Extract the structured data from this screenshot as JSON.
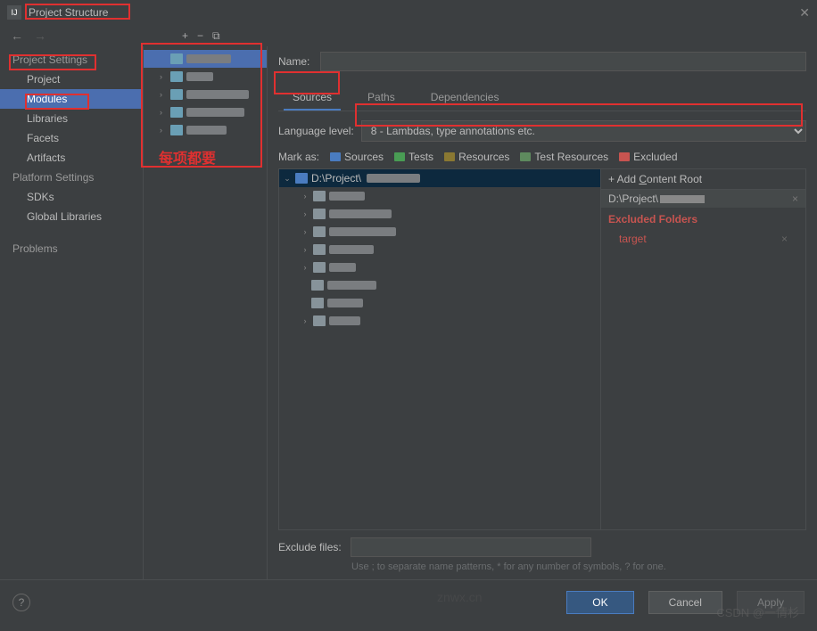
{
  "window": {
    "title": "Project Structure"
  },
  "sidebar": {
    "section1": "Project Settings",
    "items1": [
      "Project",
      "Modules",
      "Libraries",
      "Facets",
      "Artifacts"
    ],
    "section2": "Platform Settings",
    "items2": [
      "SDKs",
      "Global Libraries"
    ],
    "problems": "Problems"
  },
  "content": {
    "name_label": "Name:",
    "tabs": [
      "Sources",
      "Paths",
      "Dependencies"
    ],
    "lang_label": "Language level:",
    "lang_value": "8 - Lambdas, type annotations etc.",
    "mark_label": "Mark as:",
    "marks": {
      "sources": "Sources",
      "tests": "Tests",
      "resources": "Resources",
      "test_resources": "Test Resources",
      "excluded": "Excluded"
    },
    "tree_root": "D:\\Project\\",
    "add_root": "Add Content Root",
    "root_path": "D:\\Project\\",
    "excluded_label": "Excluded Folders",
    "target": "target",
    "exclude_label": "Exclude files:",
    "hint": "Use ; to separate name patterns, * for any number of symbols, ? for one."
  },
  "buttons": {
    "ok": "OK",
    "cancel": "Cancel",
    "apply": "Apply"
  },
  "annotation": "每项都要",
  "watermark": "CSDN @一情杉",
  "watermark2": "znwx.cn"
}
